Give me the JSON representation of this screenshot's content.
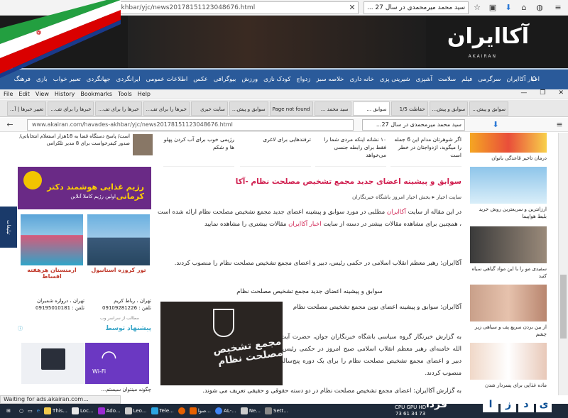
{
  "outer_browser": {
    "url": "akhbar/yjc/news20178151123048676.html",
    "search": "سید محمد میرمحمدی در سال 27 ..."
  },
  "flag_label": "فردا",
  "site": {
    "logo": "آکاایران",
    "logo_sub": "AKAIRAN",
    "nav": [
      "اخبار آکاایران",
      "سرگرمی",
      "فیلم",
      "سلامت",
      "آشپزی",
      "شیرینی پزی",
      "خانه داری",
      "خلاصه سبز",
      "زدواج",
      "کودک نازی",
      "ورزش",
      "بیوگرافی",
      "عکس",
      "اطلاعات عمومی",
      "ایرانگردی",
      "جهانگردی",
      "تعبیر خواب",
      "بازی",
      "فرهنگ"
    ]
  },
  "inner_browser": {
    "menu": [
      "File",
      "Edit",
      "View",
      "History",
      "Bookmarks",
      "Tools",
      "Help"
    ],
    "tabs": [
      "تغییر خبرها | آ...",
      "خبرها را برای تف...",
      "خبرها را برای تف...",
      "خبرها را برای تف...",
      "سایت خبری",
      "سوابق و پیش...",
      "Page not found",
      "سید محمد ...",
      "سوابق ...",
      "حقاطت 1/5",
      "سوابق و پیش...",
      "سوابق و پیش..."
    ],
    "url": "www.akairan.com/havades-akhbar/yjc/news20178151123048676.html",
    "search": "سید محمد میرمحمدی در سال 27..."
  },
  "left": {
    "news_snip": "است/ پاسخ دستگاه قضا به 18هزار استعلام انتخاباتی/ صدور کیفرخواست برای 8 مدیر تلکرامی",
    "diet_ad_title": "رژیم غذایی هوشمند دکتر کرمانی",
    "diet_ad_sub": "اولین رژیم کاملا آنلاین",
    "side_tab": "تبلیغات",
    "tours": [
      {
        "label": "تور کروزه استانبول",
        "info": "تهران ، رباط کریم\nتلفن : 09109281226"
      },
      {
        "label": "ارمنستان هرهفته اقساط",
        "info": "تهران ، دروازه شمیران\nتلفن : 09195010181"
      }
    ],
    "ad_link": "مطالب از سراسر وب",
    "suggest_title": "پیشنهاد توسط",
    "wifi_label": "Wi-Fi",
    "bottom_snip": "چگونه مینتوان سیستم..."
  },
  "article": {
    "top_cards": [
      "اگر شوهرتان مدام این 6 جمله را میگوید، ازدواجتان در خطر است",
      "۱۰ نشانه اینکه مردی شما را فقط برای رابطه جنسی می‌خواهد",
      "ترفندهایی برای لاغری",
      "رژیمی خوب برای آب کردن پهلو ها و شکم"
    ],
    "title": "سوابق و پیشینه اعضای جدید مجمع تشخیص مصلحت نظام -آکا",
    "category": "سایت اخبار  ▸  بخش اخبار امروز باشگاه خبرنگاران",
    "para1_a": "در این مقاله از سایت ",
    "para1_hl1": "آکاایران",
    "para1_b": " مطلبی در مورد سوابق و پیشینه اعضای جدید مجمع تشخیص مصلحت نظام ارائه شده است ، همچنین برای مشاهده مقالات بیشتر در دسته از سایت ",
    "para1_hl2": "اخبار آکاایران",
    "para1_c": " مقالات بیشتری را مشاهده نمایید",
    "para2": "آکاایران: رهبر معظم انقلاب اسلامی در حکمی رئیس، دبیر و اعضای مجمع تشخیص مصلحت نظام را منصوب کردند.",
    "para3": "سوابق و پیشینه اعضای جدید مجمع تشخیص مصلحت نظام",
    "para4": "آکاایران: سوابق و پیشینه اعضای نوین مجمع تشخیص مصلحت نظام",
    "para5": "به گزارش خبرنگار گروه سیاسی باشگاه خبرنگاران جوان، حضرت آیت الله خامنه‌ای رهبر معظم انقلاب اسلامی صبح امروز در حکمی رئیس، دبیر و اعضای مجمع تشخیص مصلحت نظام را برای یک دوره پنج‌ساله منصوب کردند.",
    "para6": "به گزارش آکاایران: اعضای مجمع تشخیص مصلحت نظام در دو دسته حقوقی و حقیقی تعریف می شوند.",
    "image_caption": "مجمع تشخیص مصلحت نظام"
  },
  "right": [
    {
      "t": "درمان تاخیر قاعدگی بانوان"
    },
    {
      "t": "ارزانترین و سریعترین روش خرید بلیط هواپیما"
    },
    {
      "t": "سفیدی مو را با این مواد گیاهی سیاه کنید"
    },
    {
      "t": "از بین بردن سریع پف و سیاهی زیر چشم"
    },
    {
      "t": "ماده غذایی برای پسردار شدن"
    }
  ],
  "status": "Waiting for ads.akairan.com...",
  "taskbar": [
    {
      "label": "This...",
      "color": "#f2c94c"
    },
    {
      "label": "Loc...",
      "color": "#e8e8e8"
    },
    {
      "label": "Ado...",
      "color": "#9b2bd1"
    },
    {
      "label": "Leo...",
      "color": "#cccccc"
    },
    {
      "label": "Tele...",
      "color": "#2ca5e0"
    },
    {
      "label": "",
      "color": "#e66000"
    },
    {
      "label": "صوا...",
      "color": "#e66000"
    },
    {
      "label": "AL-...",
      "color": "#4285f4"
    },
    {
      "label": "Ne...",
      "color": "#cccccc"
    },
    {
      "label": "Sett...",
      "color": "#888888"
    }
  ],
  "sys": {
    "cpu": "CPU GPU HD",
    "vals": "73  61  34  73"
  },
  "farda_letters": [
    "ی",
    "د",
    "ز",
    "ا"
  ],
  "farda_word": "فردا"
}
